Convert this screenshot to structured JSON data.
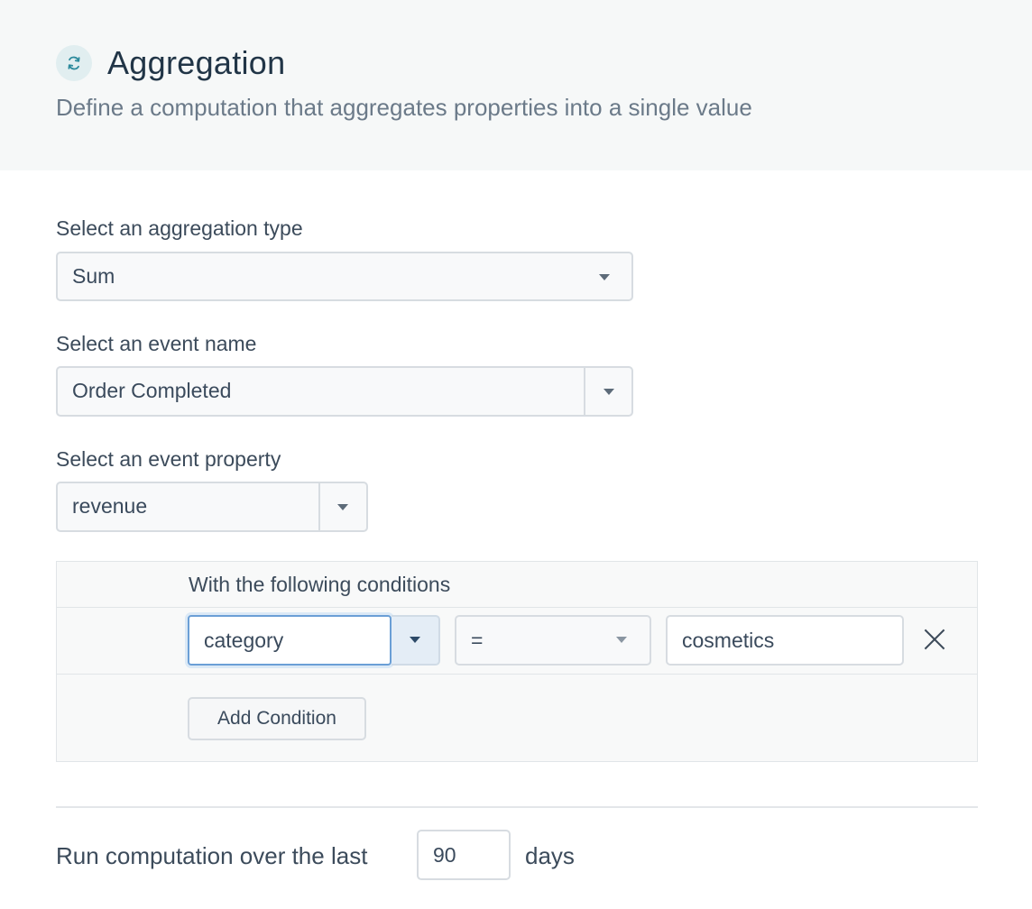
{
  "header": {
    "title": "Aggregation",
    "subtitle": "Define a computation that aggregates properties into a single value",
    "icon": "refresh-icon",
    "accent_color": "#2c8a9c"
  },
  "aggregation_type": {
    "label": "Select an aggregation type",
    "value": "Sum"
  },
  "event_name": {
    "label": "Select an event name",
    "value": "Order Completed"
  },
  "event_property": {
    "label": "Select an event property",
    "value": "revenue"
  },
  "conditions": {
    "title": "With the following conditions",
    "rows": [
      {
        "property": "category",
        "operator": "=",
        "value": "cosmetics"
      }
    ],
    "add_label": "Add Condition"
  },
  "timeframe": {
    "prefix": "Run computation over the last",
    "days_value": "90",
    "suffix": "days"
  }
}
